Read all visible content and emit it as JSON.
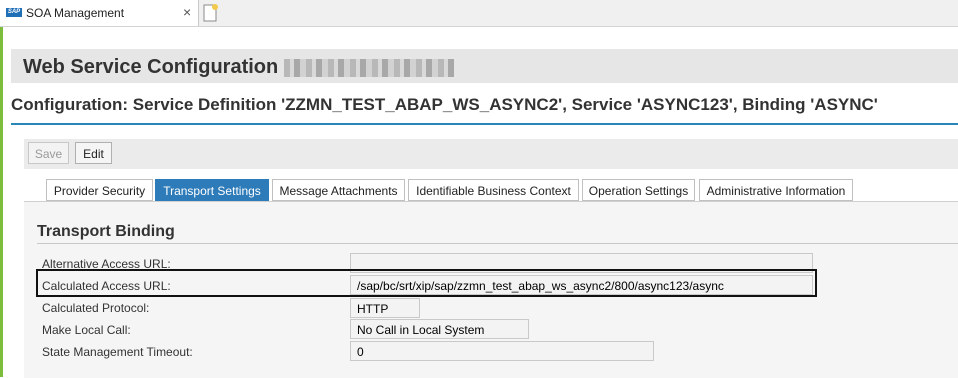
{
  "browser": {
    "tab_title": "SOA Management",
    "logo_text": "SAP",
    "close_glyph": "×"
  },
  "header": {
    "title": "Web Service Configuration"
  },
  "subtitle": "Configuration: Service Definition 'ZZMN_TEST_ABAP_WS_ASYNC2', Service 'ASYNC123', Binding 'ASYNC'",
  "toolbar": {
    "save_label": "Save",
    "edit_label": "Edit"
  },
  "tabs": [
    {
      "label": "Provider Security"
    },
    {
      "label": "Transport Settings"
    },
    {
      "label": "Message Attachments"
    },
    {
      "label": "Identifiable Business Context"
    },
    {
      "label": "Operation Settings"
    },
    {
      "label": "Administrative Information"
    }
  ],
  "section": {
    "title": "Transport Binding"
  },
  "fields": [
    {
      "label": "Alternative Access URL:",
      "value": ""
    },
    {
      "label": "Calculated Access URL:",
      "value": "/sap/bc/srt/xip/sap/zzmn_test_abap_ws_async2/800/async123/async"
    },
    {
      "label": "Calculated Protocol:",
      "value": "HTTP"
    },
    {
      "label": "Make Local Call:",
      "value": "No Call in Local System"
    },
    {
      "label": "State Management Timeout:",
      "value": "0"
    }
  ],
  "colors": {
    "accent": "#2d7bb9",
    "side_bar": "#7cbd3c"
  }
}
